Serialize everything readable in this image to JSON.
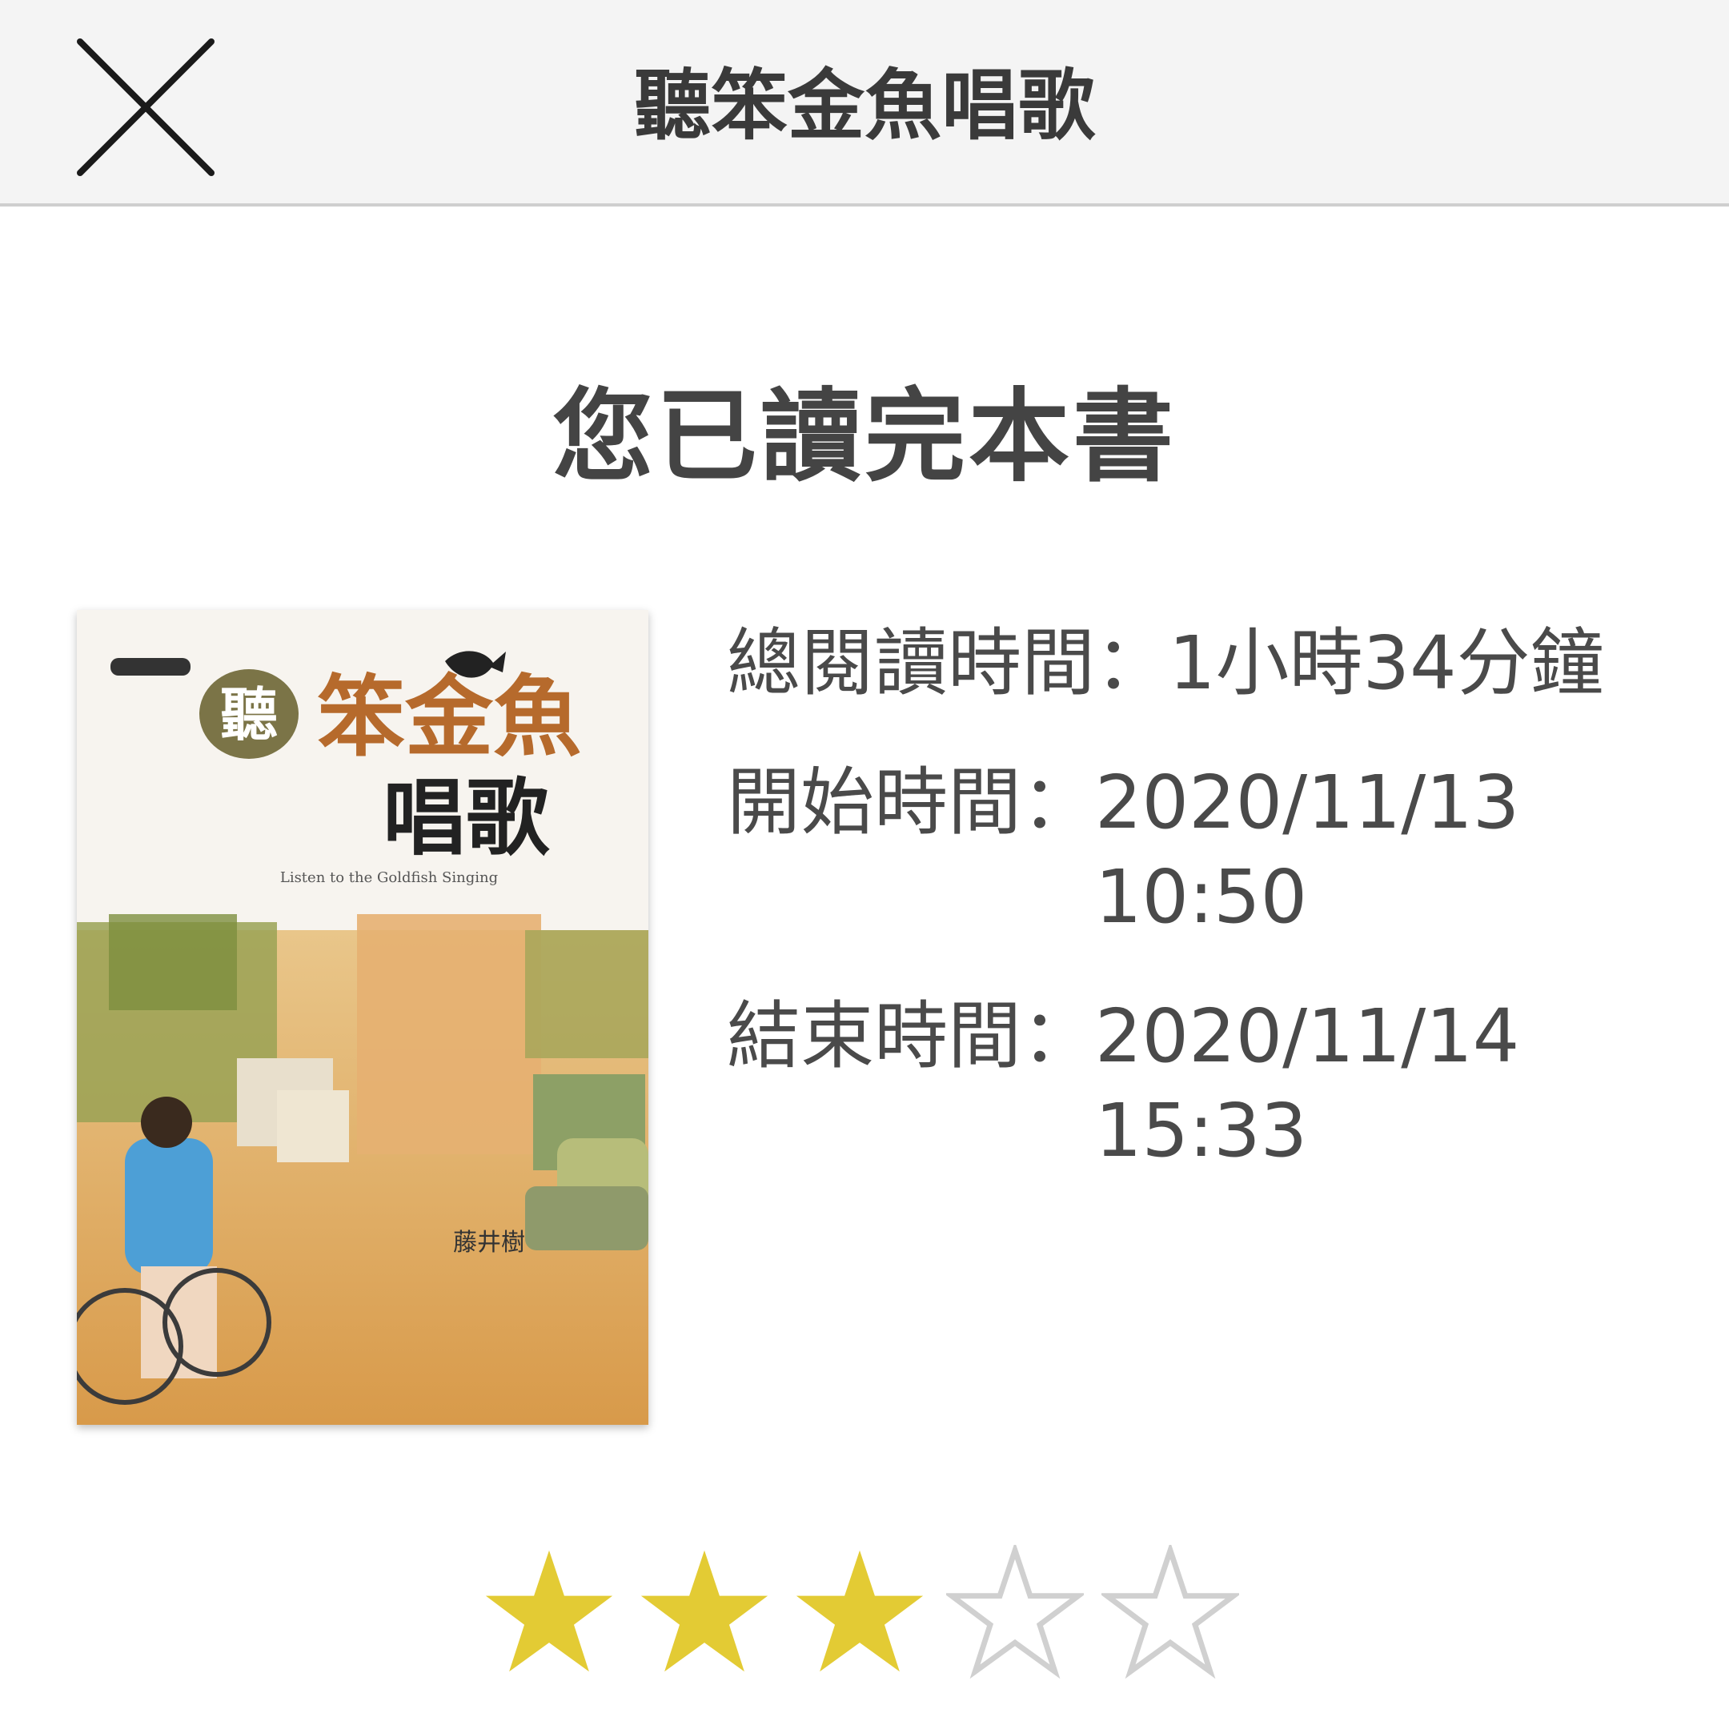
{
  "header": {
    "title": "聽笨金魚唱歌",
    "close_icon": "close-icon"
  },
  "main": {
    "heading": "您已讀完本書",
    "book": {
      "cover_title_1": "聽",
      "cover_title_2": "笨金魚",
      "cover_title_3": "唱歌",
      "cover_subtitle": "Listen to the Goldfish Singing",
      "cover_author": "藤井樹"
    },
    "stats": {
      "total_label": "總閱讀時間：",
      "total_value": "1小時34分鐘",
      "start_label": "開始時間：",
      "start_value": "2020/11/13\n10:50",
      "end_label": "結束時間：",
      "end_value": "2020/11/14\n15:33"
    },
    "rating": {
      "value": 3,
      "max": 5,
      "filled_color": "#e3cb34",
      "empty_color": "#d0d0d0"
    }
  }
}
